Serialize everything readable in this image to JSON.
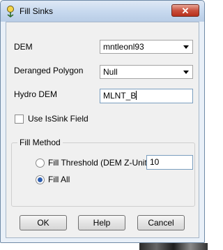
{
  "window": {
    "title": "Fill Sinks",
    "close_label": "✕"
  },
  "fields": {
    "dem_label": "DEM",
    "dem_value": "mntleonl93",
    "deranged_label": "Deranged Polygon",
    "deranged_value": "Null",
    "hydro_label": "Hydro DEM",
    "hydro_value": "MLNT_B",
    "use_issink_label": "Use IsSink Field",
    "use_issink_checked": false
  },
  "fill_method": {
    "group_label": "Fill Method",
    "threshold_label": "Fill Threshold (DEM Z-Unit)",
    "threshold_value": "10",
    "fill_all_label": "Fill All",
    "selected": "fill_all"
  },
  "buttons": {
    "ok": "OK",
    "help": "Help",
    "cancel": "Cancel"
  }
}
